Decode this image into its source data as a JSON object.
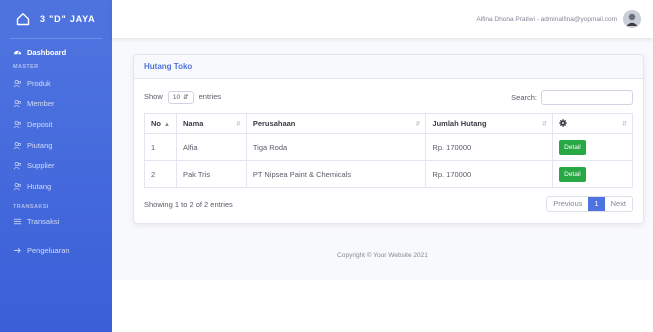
{
  "brand": {
    "text": "3 \"D\" JAYA",
    "icon": "house-outline-icon"
  },
  "sidebar": {
    "dashboard": "Dashboard",
    "heading_master": "MASTER",
    "master_items": [
      {
        "label": "Produk",
        "icon": "users-icon"
      },
      {
        "label": "Member",
        "icon": "users-icon"
      },
      {
        "label": "Deposit",
        "icon": "users-icon"
      },
      {
        "label": "Piutang",
        "icon": "users-icon"
      },
      {
        "label": "Supplier",
        "icon": "users-icon"
      },
      {
        "label": "Hutang",
        "icon": "users-icon"
      }
    ],
    "heading_transaksi": "TRANSAKSI",
    "transaksi_items": [
      {
        "label": "Transaksi",
        "icon": "list-icon"
      },
      {
        "label": "Pengeluaran",
        "icon": "arrow-icon"
      }
    ]
  },
  "topbar": {
    "user": "Alfina Dhona Pratiwi - adminalfina@yopmail.com"
  },
  "card": {
    "title": "Hutang Toko"
  },
  "table_controls": {
    "show": "Show",
    "length": "10",
    "entries": "entries",
    "search_label": "Search:",
    "search_value": ""
  },
  "table": {
    "headers": [
      "No",
      "Nama",
      "Perusahaan",
      "Jumlah Hutang",
      ""
    ],
    "settings_icon": "gear-icon",
    "rows": [
      {
        "no": "1",
        "nama": "Alfia",
        "perusahaan": "Tiga Roda",
        "jumlah": "Rp. 170000",
        "action": "Detail"
      },
      {
        "no": "2",
        "nama": "Pak Tris",
        "perusahaan": "PT Nipsea Paint & Chemicals",
        "jumlah": "Rp. 170000",
        "action": "Detail"
      }
    ]
  },
  "table_info": "Showing 1 to 2 of 2 entries",
  "pagination": {
    "previous": "Previous",
    "current": "1",
    "next": "Next"
  },
  "footer": {
    "copyright": "Copyright © Your Website 2021"
  },
  "colors": {
    "primary": "#4e73df",
    "success": "#28a745"
  }
}
